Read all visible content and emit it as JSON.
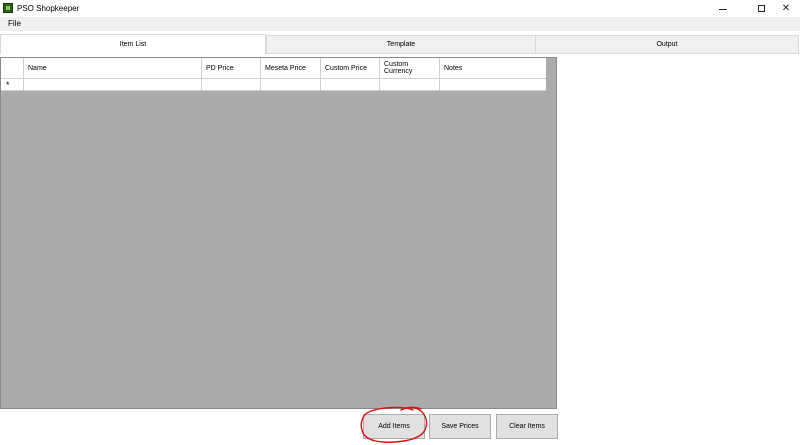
{
  "window": {
    "title": "PSO Shopkeeper",
    "icon": "app-icon",
    "controls": {
      "minimize_icon": "minimize-icon",
      "maximize_icon": "maximize-icon",
      "close_icon": "close-icon"
    }
  },
  "menu": {
    "items": [
      {
        "label": "File"
      }
    ]
  },
  "tabs": [
    {
      "label": "Item List",
      "active": true
    },
    {
      "label": "Template",
      "active": false
    },
    {
      "label": "Output",
      "active": false
    }
  ],
  "grid": {
    "columns": [
      "Name",
      "PD Price",
      "Meseta Price",
      "Custom Price",
      "Custom\nCurrency",
      "Notes"
    ],
    "new_row_marker": "*",
    "rows": []
  },
  "buttons": {
    "add": "Add Items",
    "save": "Save Prices",
    "clear": "Clear Items"
  },
  "colors": {
    "grid_background": "#ababab",
    "annotation": "#e01010"
  }
}
